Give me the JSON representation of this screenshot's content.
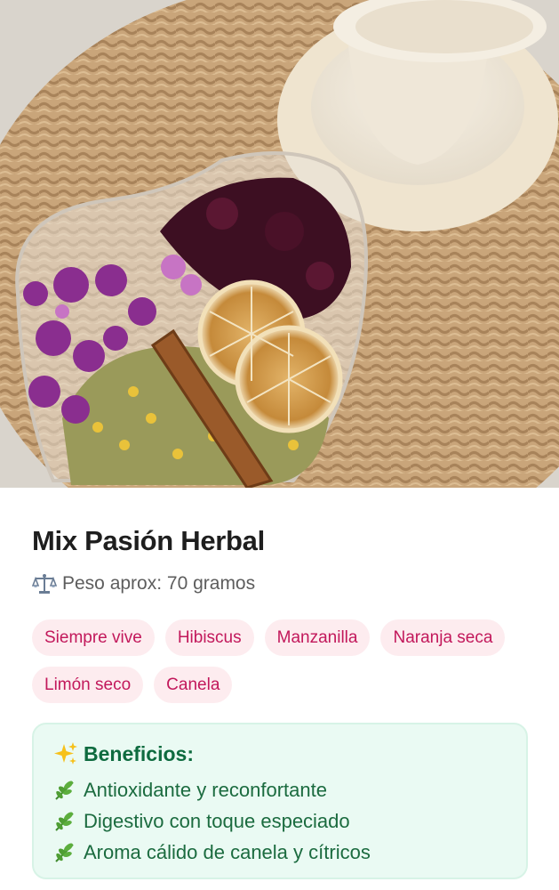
{
  "product": {
    "image_alt": "Mezcla de flores secas en recipiente de corazón",
    "title": "Mix Pasión Herbal",
    "weight_icon": "balance-scale-icon",
    "weight_text": "Peso aprox: 70 gramos",
    "ingredients": [
      "Siempre vive",
      "Hibiscus",
      "Manzanilla",
      "Naranja seca",
      "Limón seco",
      "Canela"
    ]
  },
  "benefits": {
    "icon": "sparkles-icon",
    "title": "Beneficios:",
    "item_icon": "herb-icon",
    "items": [
      "Antioxidante y reconfortante",
      "Digestivo con toque especiado",
      "Aroma cálido de canela y cítricos"
    ]
  },
  "colors": {
    "chip_bg": "#fdecef",
    "chip_text": "#c2185b",
    "benefits_bg": "#eafaf3",
    "benefits_text": "#1b6b3f"
  }
}
